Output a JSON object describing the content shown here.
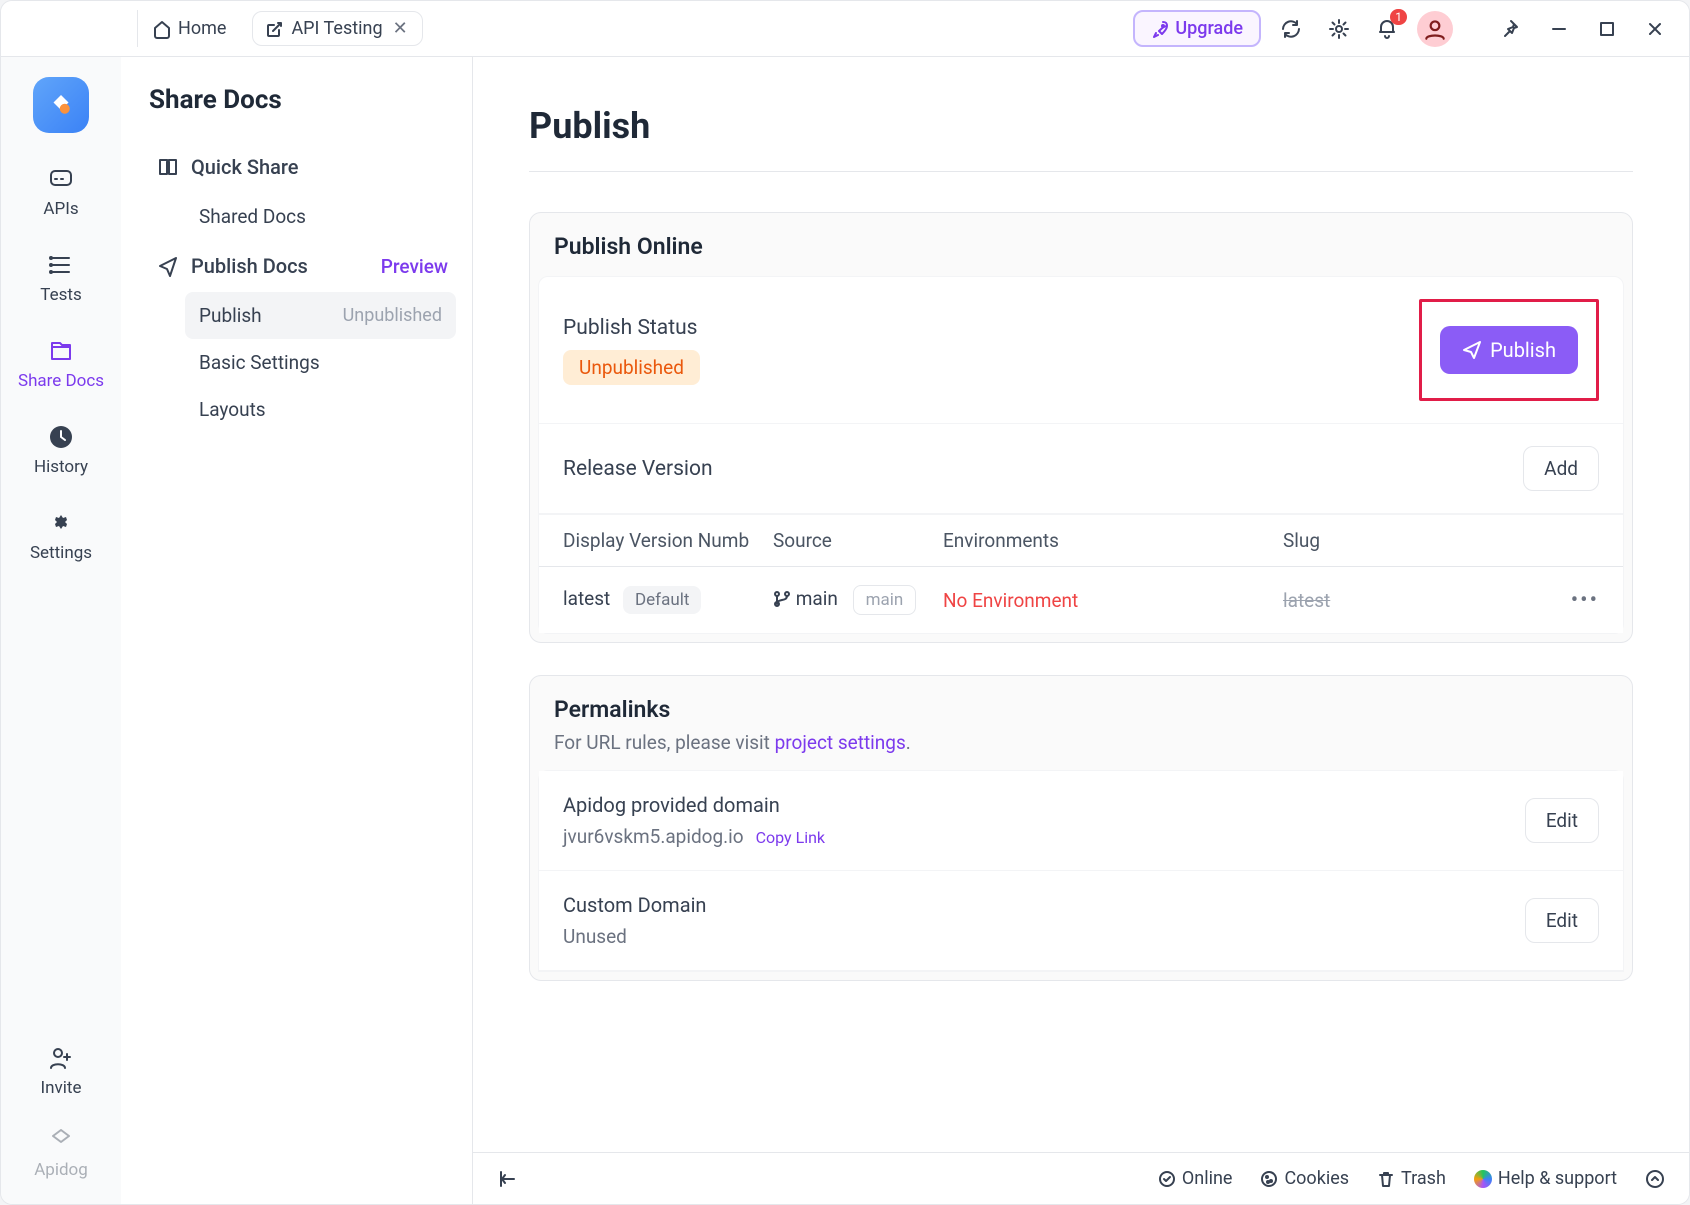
{
  "topbar": {
    "home": "Home",
    "tab": "API Testing",
    "upgrade": "Upgrade",
    "notif_count": "1"
  },
  "rail": {
    "apis": "APIs",
    "tests": "Tests",
    "share": "Share Docs",
    "history": "History",
    "settings": "Settings",
    "invite": "Invite",
    "brand": "Apidog"
  },
  "sidebar": {
    "title": "Share Docs",
    "quick_share": "Quick Share",
    "shared_docs": "Shared Docs",
    "publish_docs": "Publish Docs",
    "preview": "Preview",
    "publish": "Publish",
    "publish_status": "Unpublished",
    "basic_settings": "Basic Settings",
    "layouts": "Layouts"
  },
  "main": {
    "title": "Publish",
    "publish_online": {
      "heading": "Publish Online",
      "status_label": "Publish Status",
      "status_value": "Unpublished",
      "publish_btn": "Publish",
      "release_label": "Release Version",
      "add_btn": "Add",
      "cols": {
        "c1": "Display Version Numb",
        "c2": "Source",
        "c3": "Environments",
        "c4": "Slug"
      },
      "row": {
        "version": "latest",
        "default_chip": "Default",
        "source": "main",
        "source_chip": "main",
        "env": "No Environment",
        "slug": "latest"
      }
    },
    "permalinks": {
      "heading": "Permalinks",
      "desc_prefix": "For URL rules, please visit ",
      "desc_link": "project settings",
      "desc_suffix": ".",
      "provided_label": "Apidog provided domain",
      "provided_domain": "jvur6vskm5.apidog.io",
      "copy_link": "Copy Link",
      "edit": "Edit",
      "custom_label": "Custom Domain",
      "custom_value": "Unused"
    }
  },
  "footer": {
    "online": "Online",
    "cookies": "Cookies",
    "trash": "Trash",
    "help": "Help & support"
  }
}
